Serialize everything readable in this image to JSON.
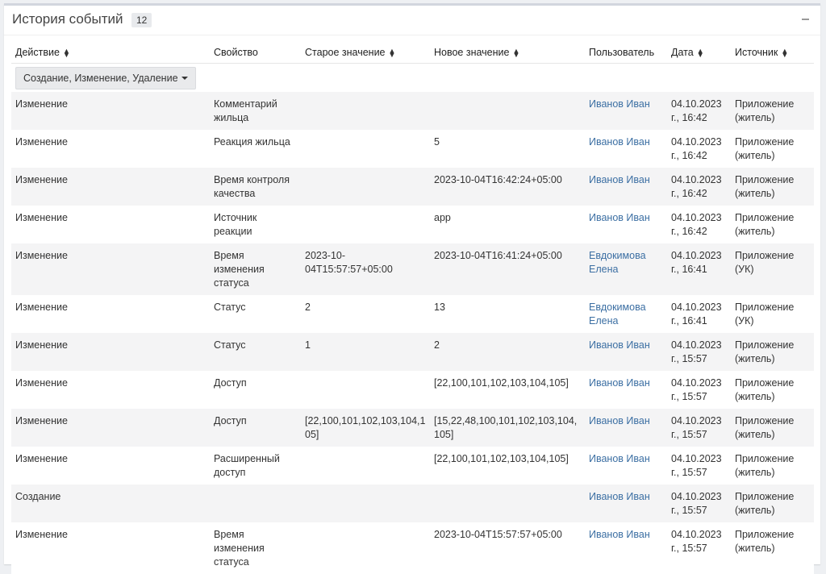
{
  "panel": {
    "title": "История событий",
    "count": "12"
  },
  "columns": [
    {
      "label": "Действие",
      "sortable": true
    },
    {
      "label": "Свойство",
      "sortable": false
    },
    {
      "label": "Старое значение",
      "sortable": true
    },
    {
      "label": "Новое значение",
      "sortable": true
    },
    {
      "label": "Пользователь",
      "sortable": false
    },
    {
      "label": "Дата",
      "sortable": true
    },
    {
      "label": "Источник",
      "sortable": true
    }
  ],
  "filter": {
    "label": "Создание, Изменение, Удаление"
  },
  "rows": [
    {
      "action": "Изменение",
      "property": "Комментарий жильца",
      "old": "",
      "new": "",
      "user": "Иванов Иван",
      "date": "04.10.2023 г., 16:42",
      "source": "Приложение (житель)"
    },
    {
      "action": "Изменение",
      "property": "Реакция жильца",
      "old": "",
      "new": "5",
      "user": "Иванов Иван",
      "date": "04.10.2023 г., 16:42",
      "source": "Приложение (житель)"
    },
    {
      "action": "Изменение",
      "property": "Время контроля качества",
      "old": "",
      "new": "2023-10-04T16:42:24+05:00",
      "user": "Иванов Иван",
      "date": "04.10.2023 г., 16:42",
      "source": "Приложение (житель)"
    },
    {
      "action": "Изменение",
      "property": "Источник реакции",
      "old": "",
      "new": "app",
      "user": "Иванов Иван",
      "date": "04.10.2023 г., 16:42",
      "source": "Приложение (житель)"
    },
    {
      "action": "Изменение",
      "property": "Время изменения статуса",
      "old": "2023-10-04T15:57:57+05:00",
      "new": "2023-10-04T16:41:24+05:00",
      "user": "Евдокимова Елена",
      "date": "04.10.2023 г., 16:41",
      "source": "Приложение (УК)"
    },
    {
      "action": "Изменение",
      "property": "Статус",
      "old": "2",
      "new": "13",
      "user": "Евдокимова Елена",
      "date": "04.10.2023 г., 16:41",
      "source": "Приложение (УК)"
    },
    {
      "action": "Изменение",
      "property": "Статус",
      "old": "1",
      "new": "2",
      "user": "Иванов Иван",
      "date": "04.10.2023 г., 15:57",
      "source": "Приложение (житель)"
    },
    {
      "action": "Изменение",
      "property": "Доступ",
      "old": "",
      "new": "[22,100,101,102,103,104,105]",
      "user": "Иванов Иван",
      "date": "04.10.2023 г., 15:57",
      "source": "Приложение (житель)"
    },
    {
      "action": "Изменение",
      "property": "Доступ",
      "old": "[22,100,101,102,103,104,105]",
      "new": "[15,22,48,100,101,102,103,104,105]",
      "user": "Иванов Иван",
      "date": "04.10.2023 г., 15:57",
      "source": "Приложение (житель)"
    },
    {
      "action": "Изменение",
      "property": "Расширенный доступ",
      "old": "",
      "new": "[22,100,101,102,103,104,105]",
      "user": "Иванов Иван",
      "date": "04.10.2023 г., 15:57",
      "source": "Приложение (житель)"
    },
    {
      "action": "Создание",
      "property": "",
      "old": "",
      "new": "",
      "user": "Иванов Иван",
      "date": "04.10.2023 г., 15:57",
      "source": "Приложение (житель)"
    },
    {
      "action": "Изменение",
      "property": "Время изменения статуса",
      "old": "",
      "new": "2023-10-04T15:57:57+05:00",
      "user": "Иванов Иван",
      "date": "04.10.2023 г., 15:57",
      "source": "Приложение (житель)"
    }
  ]
}
